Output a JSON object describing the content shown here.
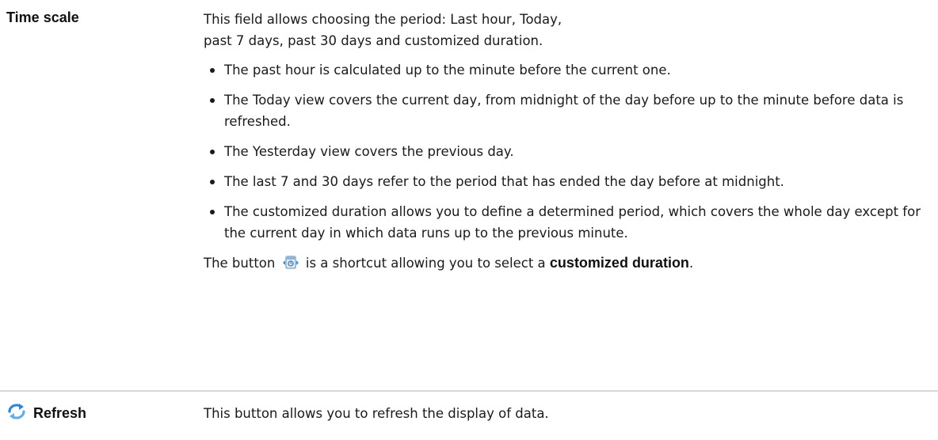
{
  "time_scale": {
    "term": "Time scale",
    "intro_line1": "This field allows choosing the period: Last hour, Today,",
    "intro_line2": "past 7 days, past 30 days and customized duration.",
    "bullets": [
      "The past hour is calculated up to the minute before the current one.",
      "The Today view covers the current day, from midnight of the day before up to the minute before data is refreshed.",
      "The Yesterday view covers the previous day.",
      "The last 7 and 30 days refer to the period that has ended the day before at midnight.",
      "The customized duration allows you to define a determined period, which covers the whole day except for the current day in which data runs up to the previous minute."
    ],
    "shortcut_prefix": "The button",
    "shortcut_mid": "is a shortcut allowing you to select a",
    "shortcut_strong": "customized duration",
    "shortcut_end": "."
  },
  "refresh": {
    "term": "Refresh",
    "description": "This button allows you to refresh the display of data."
  },
  "icons": {
    "calendar": "calendar-button-icon",
    "refresh": "refresh-icon"
  }
}
